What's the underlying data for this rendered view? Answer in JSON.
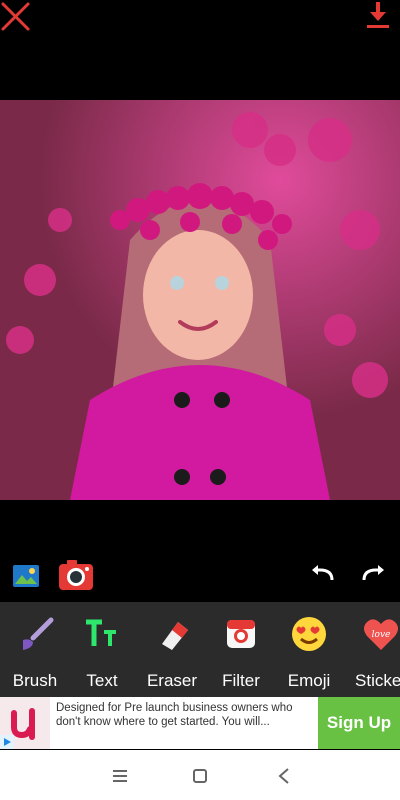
{
  "toolbar": {
    "close_icon": "x-icon",
    "download_icon": "download-icon"
  },
  "photo": {
    "description_icon": "photo"
  },
  "mini_tools": {
    "gallery_icon": "gallery-icon",
    "camera_icon": "camera-icon",
    "undo_icon": "undo-icon",
    "redo_icon": "redo-icon"
  },
  "tools": [
    {
      "label": "Brush",
      "icon": "brush-icon"
    },
    {
      "label": "Text",
      "icon": "text-icon"
    },
    {
      "label": "Eraser",
      "icon": "eraser-icon"
    },
    {
      "label": "Filter",
      "icon": "filter-icon"
    },
    {
      "label": "Emoji",
      "icon": "emoji-icon"
    },
    {
      "label": "Sticker",
      "icon": "sticker-icon"
    }
  ],
  "ad": {
    "text": "Designed for Pre launch business owners who don't know where to get started. You will...",
    "cta": "Sign Up"
  },
  "colors": {
    "accent_red": "#e53935",
    "tool_bar": "#2b2b2b",
    "ad_green": "#68c142"
  }
}
